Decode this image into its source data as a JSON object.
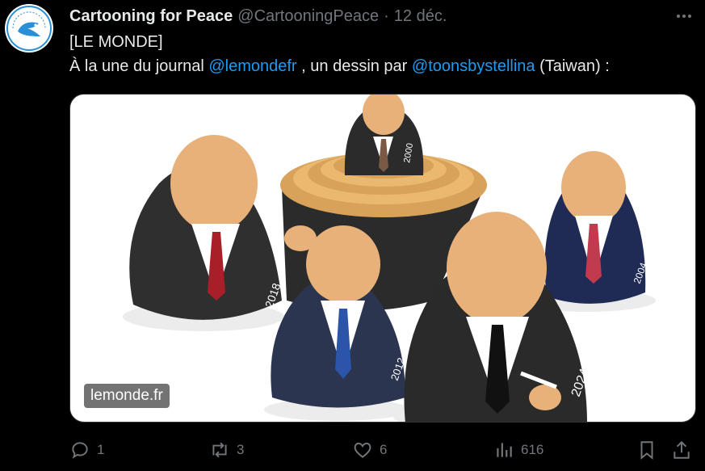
{
  "author": {
    "name": "Cartooning for Peace",
    "handle": "@CartooningPeace",
    "separator": "·",
    "date": "12 déc.",
    "avatar_icon": "cartooning-for-peace-logo"
  },
  "tweet": {
    "line1": "[LE MONDE]",
    "line2_prefix": "À la une du journal ",
    "mention1": "@lemondefr",
    "line2_middle": " , un dessin par ",
    "mention2": "@toonsbystellina",
    "line2_suffix": " (Taiwan) :"
  },
  "media": {
    "credit": "lemonde.fr",
    "doll_labels": [
      "2018",
      "2000",
      "2012",
      "2004",
      "2024"
    ]
  },
  "actions": {
    "replies": "1",
    "reposts": "3",
    "likes": "6",
    "views": "616"
  },
  "colors": {
    "link": "#1d9bf0",
    "muted": "#71767b",
    "text": "#e7e9ea"
  }
}
